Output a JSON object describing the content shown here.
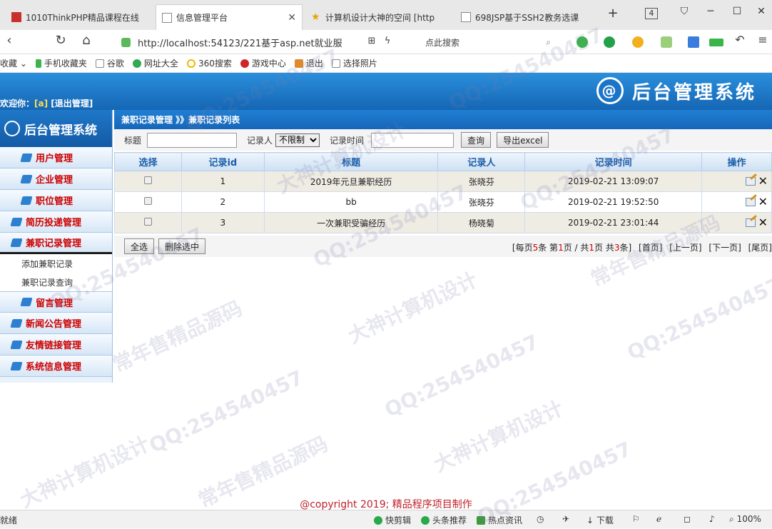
{
  "browser": {
    "tabs": [
      {
        "label": "1010ThinkPHP精品课程在线",
        "active": false
      },
      {
        "label": "信息管理平台",
        "active": true
      },
      {
        "label": "计算机设计大神的空间 [http",
        "active": false
      },
      {
        "label": "698JSP基于SSH2教务选课",
        "active": false
      }
    ],
    "new_tab_symbol": "+",
    "tab_count": "4",
    "url": "http://localhost:54123/221基于asp.net就业服",
    "url_host_bold": "localhost",
    "search_placeholder": "点此搜索",
    "bookmarks": [
      "收藏",
      "手机收藏夹",
      "谷歌",
      "网址大全",
      "360搜索",
      "游戏中心",
      "退出",
      "选择照片"
    ],
    "status_left": "就绪",
    "status_items": [
      "快剪辑",
      "头条推荐",
      "热点资讯",
      "下载",
      "100%"
    ]
  },
  "header": {
    "welcome_prefix": "欢迎你：",
    "username": "[a]",
    "logout": "[退出管理]",
    "brand_title": "后台管理系统",
    "brand_logo": "@"
  },
  "sidebar": {
    "title": "后台管理系统",
    "items": [
      {
        "label": "用户管理"
      },
      {
        "label": "企业管理"
      },
      {
        "label": "职位管理"
      },
      {
        "label": "简历投递管理"
      },
      {
        "label": "兼职记录管理"
      }
    ],
    "subitems": [
      "添加兼职记录",
      "兼职记录查询"
    ],
    "items2": [
      {
        "label": "留言管理"
      },
      {
        "label": "新闻公告管理"
      },
      {
        "label": "友情链接管理"
      },
      {
        "label": "系统信息管理"
      }
    ]
  },
  "breadcrumb": "兼职记录管理 》》兼职记录列表",
  "filter": {
    "title_label": "标题",
    "recorder_label": "记录人",
    "recorder_value": "不限制",
    "time_label": "记录时间",
    "search_button": "查询",
    "export_button": "导出excel"
  },
  "table": {
    "columns": [
      "选择",
      "记录id",
      "标题",
      "记录人",
      "记录时间",
      "操作"
    ],
    "rows": [
      {
        "id": "1",
        "title": "2019年元旦兼职经历",
        "recorder": "张晓芬",
        "time": "2019-02-21 13:09:07"
      },
      {
        "id": "2",
        "title": "bb",
        "recorder": "张晓芬",
        "time": "2019-02-21 19:52:50"
      },
      {
        "id": "3",
        "title": "一次兼职受骗经历",
        "recorder": "杨晓菊",
        "time": "2019-02-21 23:01:44"
      }
    ]
  },
  "bottom": {
    "select_all": "全选",
    "delete_selected": "删除选中",
    "pager": {
      "p1": "[每页",
      "per_page": "5",
      "p2": "条 第",
      "page": "1",
      "p3": "页 / 共",
      "total_pages": "1",
      "p4": "页 共",
      "total": "3",
      "p5": "条]",
      "first": "[首页]",
      "prev": "[上一页]",
      "next": "[下一页]",
      "last": "[尾页]"
    }
  },
  "footer": {
    "copyright": "@copyright 2019; 精品程序项目制作"
  },
  "watermarks": [
    "QQ:254540457",
    "大神计算机设计",
    "常年售精品源码"
  ],
  "colors": {
    "header_blue": "#1f78c9",
    "menu_red": "#cc0000",
    "copyright_red": "#c0202a"
  }
}
